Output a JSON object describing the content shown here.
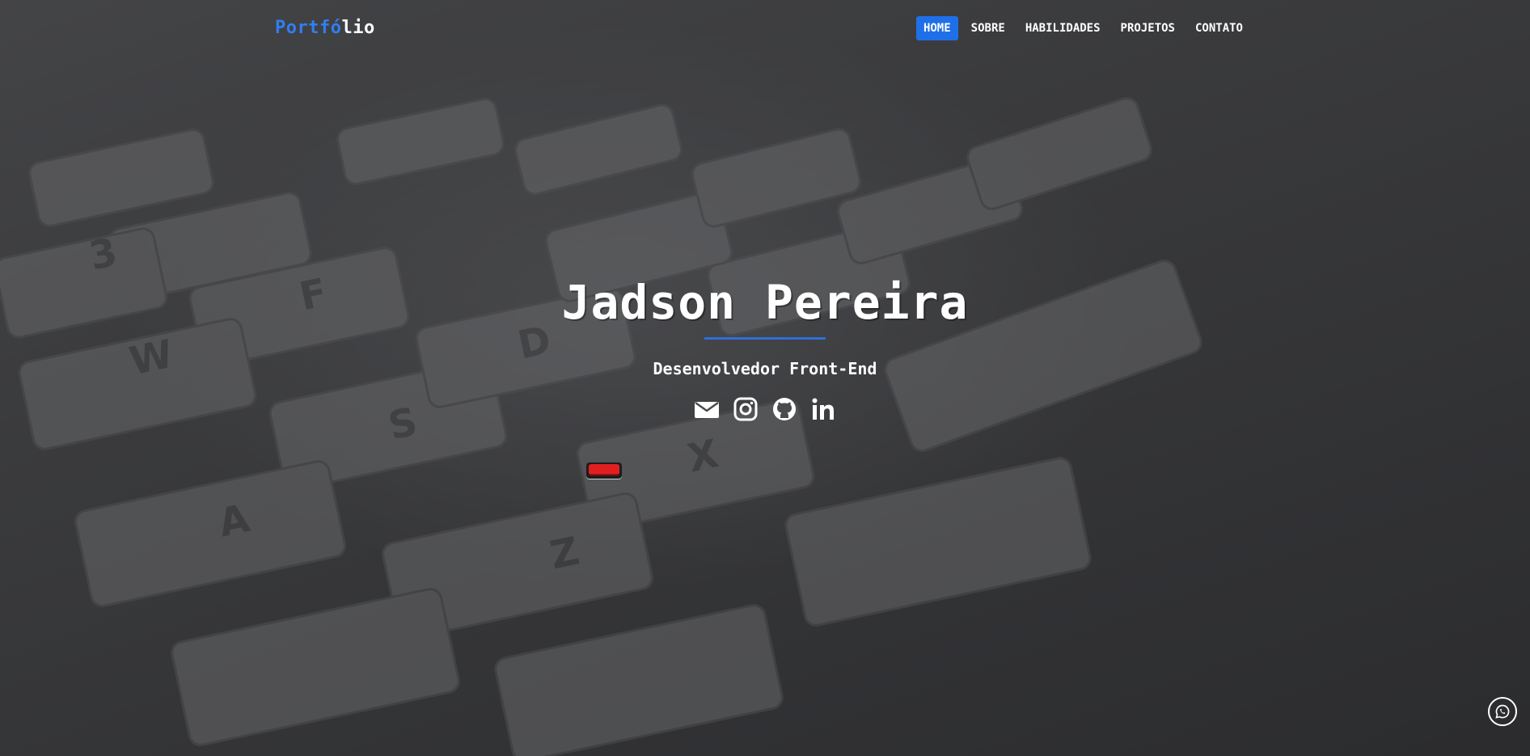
{
  "brand": {
    "part_blue": "Portfó",
    "part_white": "lio"
  },
  "nav": {
    "items": [
      {
        "label": "HOME",
        "active": true
      },
      {
        "label": "SOBRE",
        "active": false
      },
      {
        "label": "HABILIDADES",
        "active": false
      },
      {
        "label": "PROJETOS",
        "active": false
      },
      {
        "label": "CONTATO",
        "active": false
      }
    ]
  },
  "hero": {
    "name": "Jadson Pereira",
    "role": "Desenvolvedor Front-End",
    "socials": [
      "envelope-icon",
      "instagram-icon",
      "github-icon",
      "linkedin-icon"
    ]
  },
  "colors": {
    "accent": "#1f6fe8",
    "brand_blue": "#2f7ff0",
    "underline": "#2f6fd6",
    "text": "#ffffff"
  },
  "floating": {
    "whatsapp_icon": "whatsapp-icon",
    "red_button_icon": "red-toggle-button"
  }
}
